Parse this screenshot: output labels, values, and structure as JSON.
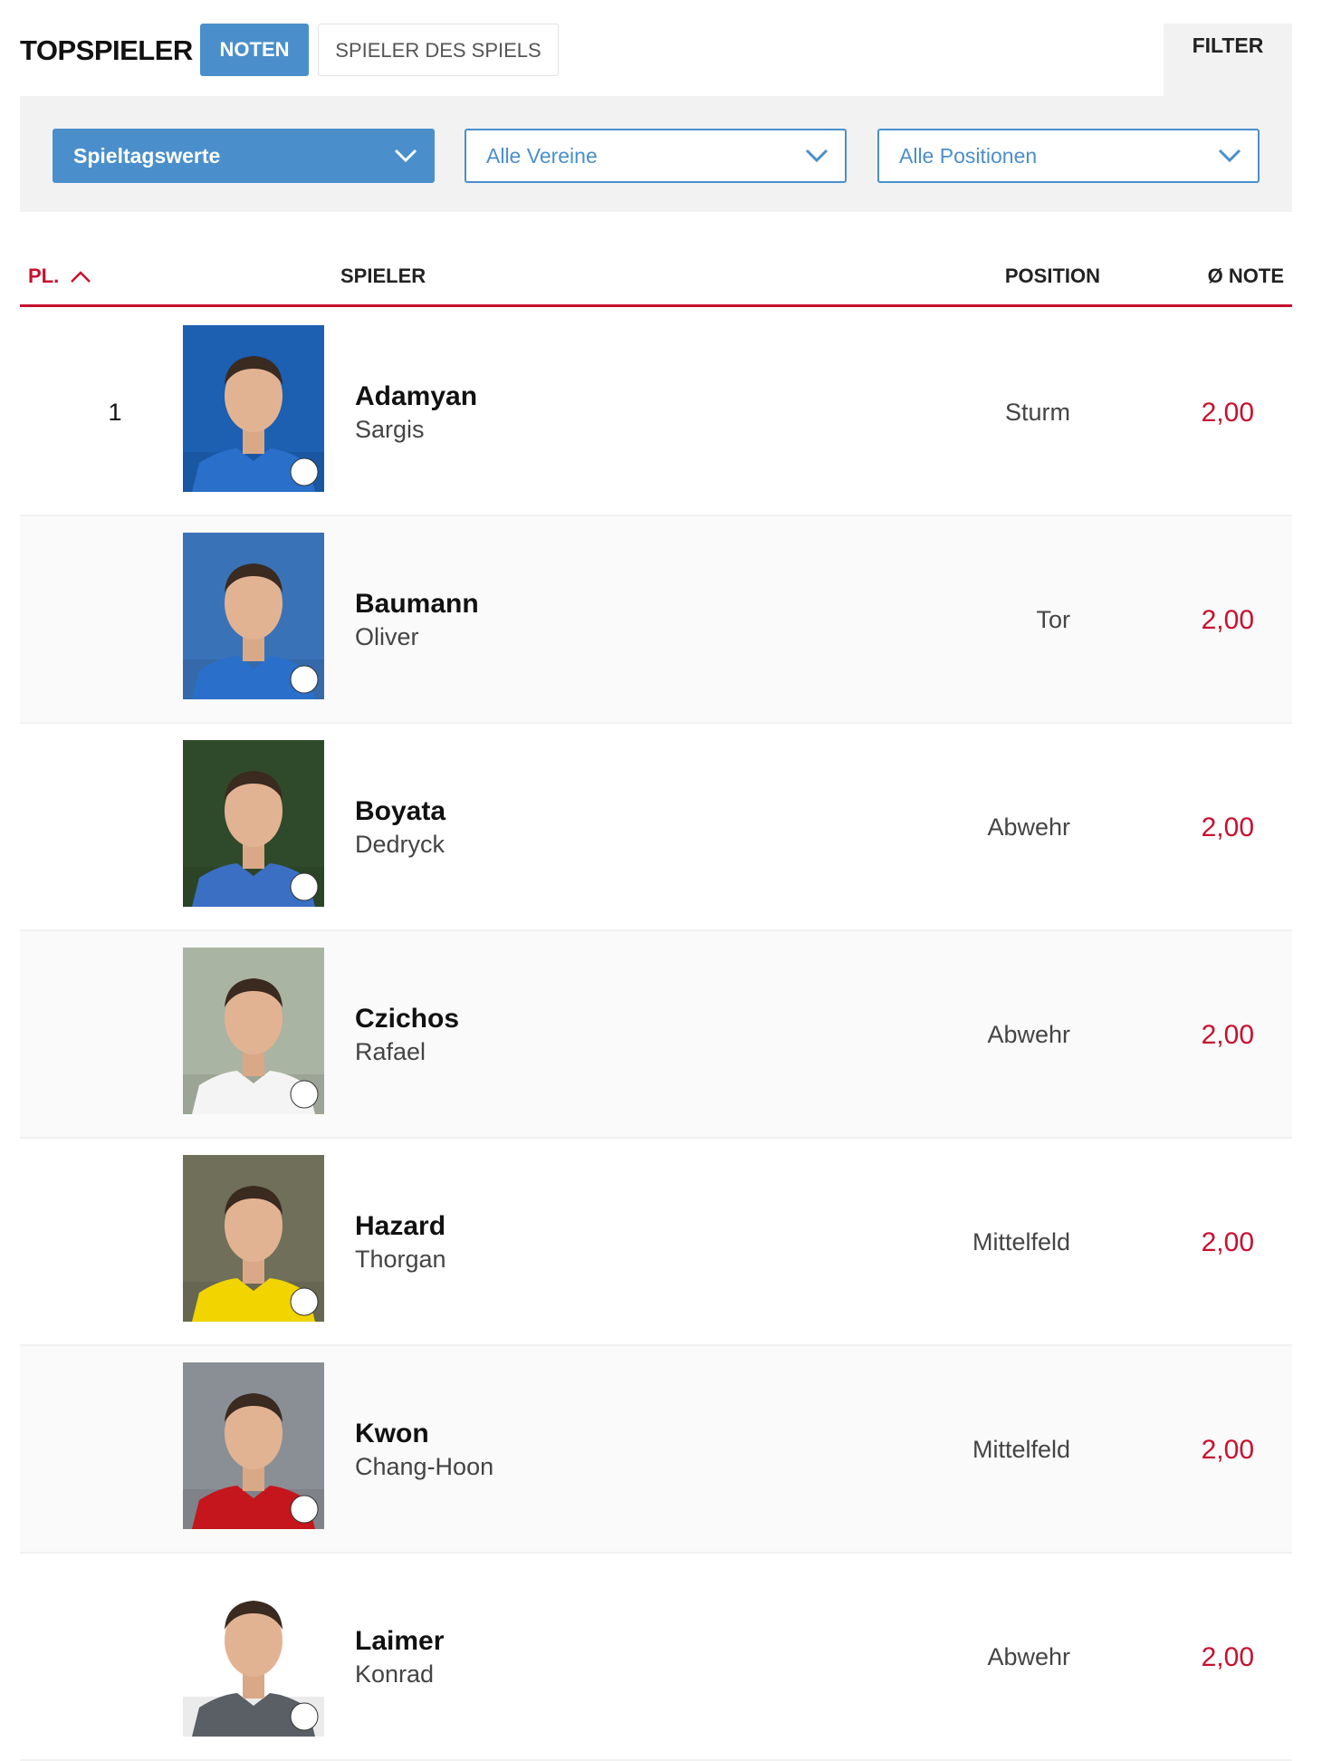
{
  "header": {
    "title": "TOPSPIELER",
    "tabs": [
      {
        "label": "NOTEN",
        "active": true
      },
      {
        "label": "SPIELER DES SPIELS",
        "active": false
      }
    ],
    "filter_label": "FILTER"
  },
  "filters": {
    "matchday": "Spieltagswerte",
    "club": "Alle Vereine",
    "position": "Alle Positionen"
  },
  "table": {
    "headers": {
      "rank": "PL.",
      "player": "SPIELER",
      "position": "POSITION",
      "rating": "Ø NOTE"
    },
    "rows": [
      {
        "rank": "1",
        "last_name": "Adamyan",
        "first_name": "Sargis",
        "position": "Sturm",
        "rating": "2,00",
        "photo_bg": "#1d5fb0",
        "shirt": "#2a6fc9"
      },
      {
        "rank": "",
        "last_name": "Baumann",
        "first_name": "Oliver",
        "position": "Tor",
        "rating": "2,00",
        "photo_bg": "#3a72b8",
        "shirt": "#2a6fc9"
      },
      {
        "rank": "",
        "last_name": "Boyata",
        "first_name": "Dedryck",
        "position": "Abwehr",
        "rating": "2,00",
        "photo_bg": "#2f4a2a",
        "shirt": "#3a6fc4"
      },
      {
        "rank": "",
        "last_name": "Czichos",
        "first_name": "Rafael",
        "position": "Abwehr",
        "rating": "2,00",
        "photo_bg": "#aab4a2",
        "shirt": "#f4f4f4"
      },
      {
        "rank": "",
        "last_name": "Hazard",
        "first_name": "Thorgan",
        "position": "Mittelfeld",
        "rating": "2,00",
        "photo_bg": "#6f6f5a",
        "shirt": "#f1d400"
      },
      {
        "rank": "",
        "last_name": "Kwon",
        "first_name": "Chang-Hoon",
        "position": "Mittelfeld",
        "rating": "2,00",
        "photo_bg": "#8a8f95",
        "shirt": "#c4161c"
      },
      {
        "rank": "",
        "last_name": "Laimer",
        "first_name": "Konrad",
        "position": "Abwehr",
        "rating": "2,00",
        "photo_bg": "#ffffff",
        "shirt": "#5a5f66"
      }
    ]
  },
  "colors": {
    "accent_blue": "#4a8fcb",
    "accent_red": "#c8102e",
    "panel_grey": "#f2f2f2"
  }
}
